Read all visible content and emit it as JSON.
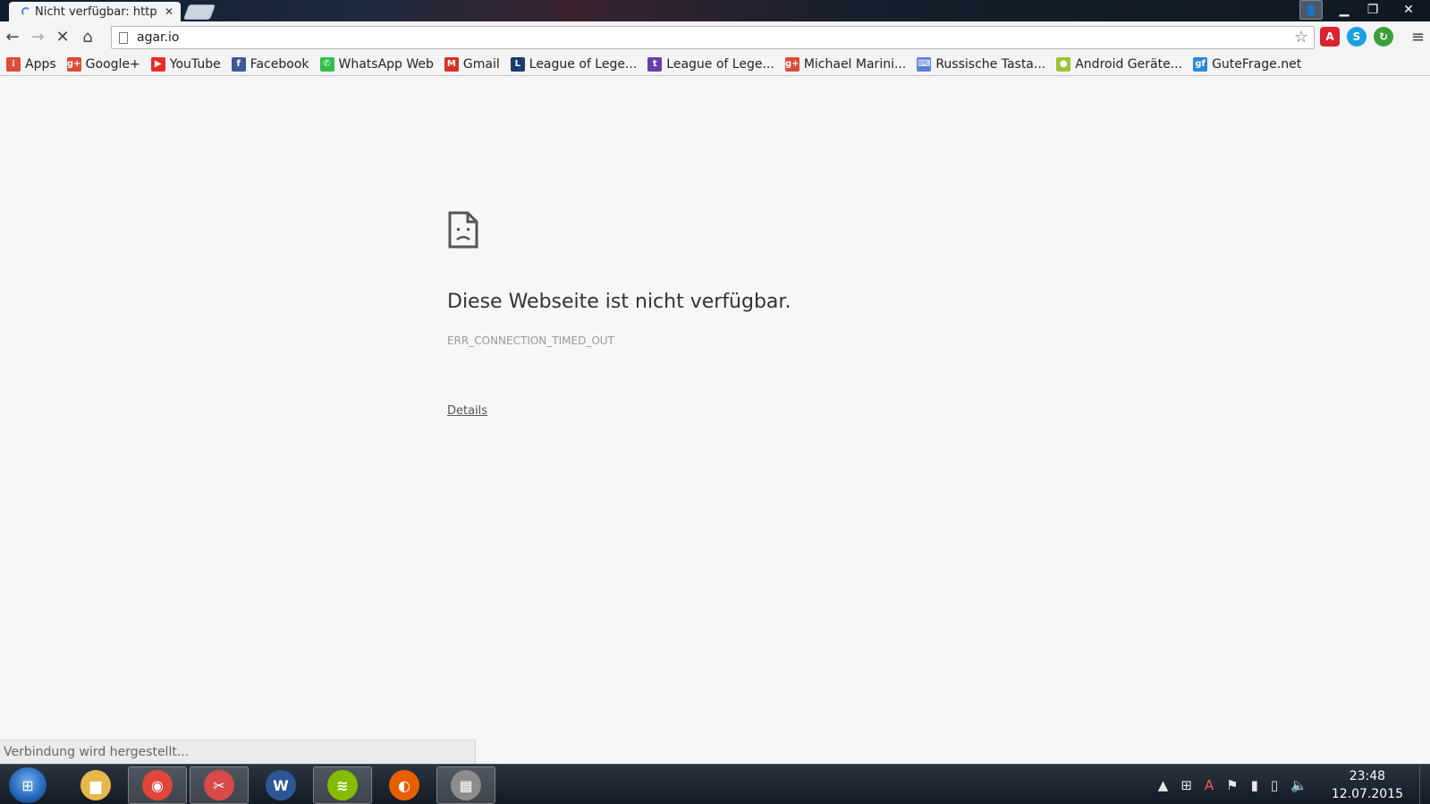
{
  "tab": {
    "title": "Nicht verfügbar: http"
  },
  "window": {
    "controls": [
      "user-icon",
      "minimize-icon",
      "restore-icon",
      "close-icon"
    ]
  },
  "toolbar": {
    "url": "agar.io"
  },
  "bookmarks": [
    {
      "label": "Apps",
      "icon": "apps-grid-icon",
      "color": "#e04a3a"
    },
    {
      "label": "Google+",
      "icon": "google-plus-icon",
      "color": "#dd4b39"
    },
    {
      "label": "YouTube",
      "icon": "youtube-icon",
      "color": "#e52d27"
    },
    {
      "label": "Facebook",
      "icon": "facebook-icon",
      "color": "#3b5998"
    },
    {
      "label": "WhatsApp Web",
      "icon": "whatsapp-icon",
      "color": "#2fbf4a"
    },
    {
      "label": "Gmail",
      "icon": "gmail-icon",
      "color": "#d93025"
    },
    {
      "label": "League of Lege...",
      "icon": "league-icon",
      "color": "#1c3a6e"
    },
    {
      "label": "League of Lege...",
      "icon": "twitch-icon",
      "color": "#6441a5"
    },
    {
      "label": "Michael Marini...",
      "icon": "google-plus-icon",
      "color": "#dd4b39"
    },
    {
      "label": "Russische Tasta...",
      "icon": "keyboard-icon",
      "color": "#5b7fd6"
    },
    {
      "label": "Android Geräte...",
      "icon": "android-icon",
      "color": "#9bc438"
    },
    {
      "label": "GuteFrage.net",
      "icon": "gutefrage-icon",
      "color": "#2a88d8"
    }
  ],
  "error": {
    "title": "Diese Webseite ist nicht verfügbar.",
    "code": "ERR_CONNECTION_TIMED_OUT",
    "details_label": "Details"
  },
  "status": {
    "text": "Verbindung wird hergestellt..."
  },
  "taskbar": {
    "apps": [
      {
        "name": "explorer",
        "icon": "folder-icon",
        "color": "#e6b84c",
        "active": false
      },
      {
        "name": "chrome",
        "icon": "chrome-icon",
        "color": "#e0463a",
        "active": true
      },
      {
        "name": "snipping-tool",
        "icon": "scissors-icon",
        "color": "#d84a4a",
        "active": true
      },
      {
        "name": "word",
        "icon": "word-icon",
        "color": "#2b5797",
        "active": false
      },
      {
        "name": "spotify",
        "icon": "spotify-icon",
        "color": "#84bd00",
        "active": true
      },
      {
        "name": "firefox",
        "icon": "firefox-icon",
        "color": "#e66000",
        "active": false
      },
      {
        "name": "unknown-app",
        "icon": "wall-icon",
        "color": "#8d8d8d",
        "active": true
      }
    ],
    "time": "23:48",
    "date": "12.07.2015"
  }
}
